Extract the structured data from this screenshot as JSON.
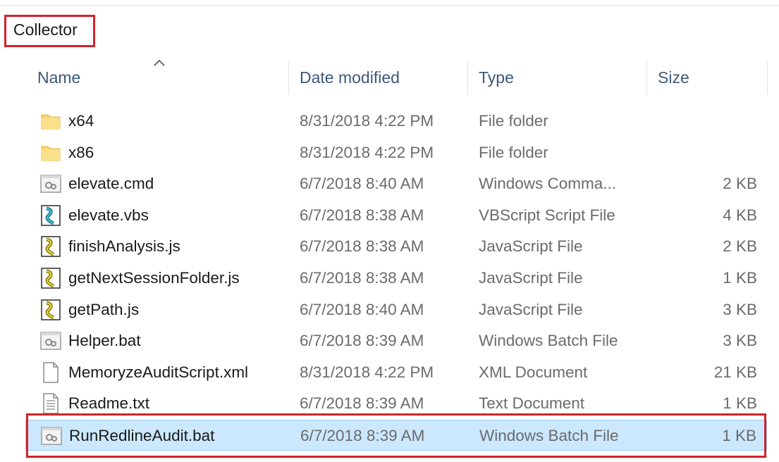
{
  "breadcrumb": {
    "label": "Collector"
  },
  "columns": {
    "name": "Name",
    "date_modified": "Date modified",
    "type": "Type",
    "size": "Size"
  },
  "files": [
    {
      "name": "x64",
      "date": "8/31/2018 4:22 PM",
      "type": "File folder",
      "size": "",
      "icon": "folder-icon"
    },
    {
      "name": "x86",
      "date": "8/31/2018 4:22 PM",
      "type": "File folder",
      "size": "",
      "icon": "folder-icon"
    },
    {
      "name": "elevate.cmd",
      "date": "6/7/2018 8:40 AM",
      "type": "Windows Comma...",
      "size": "2 KB",
      "icon": "cmd-file-icon"
    },
    {
      "name": "elevate.vbs",
      "date": "6/7/2018 8:38 AM",
      "type": "VBScript Script File",
      "size": "4 KB",
      "icon": "vbscript-file-icon"
    },
    {
      "name": "finishAnalysis.js",
      "date": "6/7/2018 8:38 AM",
      "type": "JavaScript File",
      "size": "2 KB",
      "icon": "javascript-file-icon"
    },
    {
      "name": "getNextSessionFolder.js",
      "date": "6/7/2018 8:38 AM",
      "type": "JavaScript File",
      "size": "1 KB",
      "icon": "javascript-file-icon"
    },
    {
      "name": "getPath.js",
      "date": "6/7/2018 8:40 AM",
      "type": "JavaScript File",
      "size": "3 KB",
      "icon": "javascript-file-icon"
    },
    {
      "name": "Helper.bat",
      "date": "6/7/2018 8:39 AM",
      "type": "Windows Batch File",
      "size": "3 KB",
      "icon": "batch-file-icon"
    },
    {
      "name": "MemoryzeAuditScript.xml",
      "date": "8/31/2018 4:22 PM",
      "type": "XML Document",
      "size": "21 KB",
      "icon": "xml-file-icon"
    },
    {
      "name": "Readme.txt",
      "date": "6/7/2018 8:39 AM",
      "type": "Text Document",
      "size": "1 KB",
      "icon": "text-file-icon"
    },
    {
      "name": "RunRedlineAudit.bat",
      "date": "6/7/2018 8:39 AM",
      "type": "Windows Batch File",
      "size": "1 KB",
      "icon": "batch-file-icon",
      "selected": true
    }
  ],
  "colors": {
    "annotation": "#d2232a",
    "selection_bg": "#cce8ff",
    "header_text": "#3c5a7a"
  }
}
